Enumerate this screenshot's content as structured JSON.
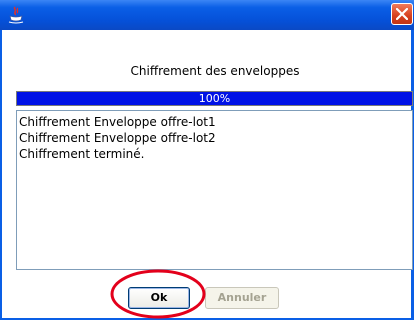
{
  "dialog": {
    "heading": "Chiffrement des enveloppes",
    "progress_text": "100%",
    "progress_value": 1.0,
    "log_lines": [
      "Chiffrement Enveloppe offre-lot1",
      "Chiffrement Enveloppe offre-lot2",
      "Chiffrement terminé."
    ],
    "ok_label": "Ok",
    "cancel_label": "Annuler"
  },
  "icons": {
    "app": "java-icon",
    "close": "close-icon"
  },
  "colors": {
    "titlebar": "#0a5fe6",
    "progress_fill": "#0012e6",
    "highlight_circle": "#e3001b",
    "close_button": "#d6401e"
  }
}
